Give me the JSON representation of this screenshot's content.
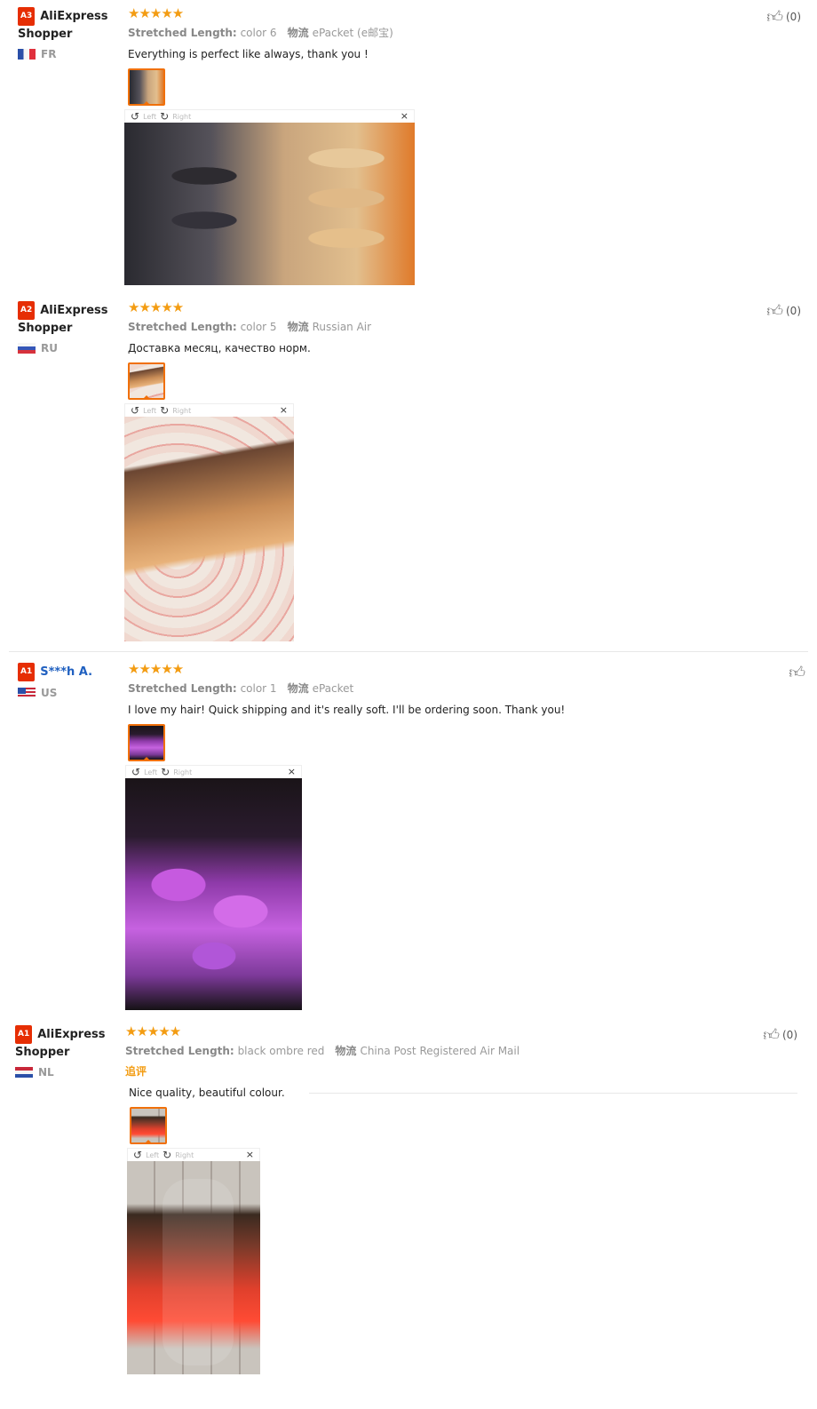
{
  "reviews": [
    {
      "level": "A3",
      "user": "AliExpress Shopper",
      "country": "FR",
      "stars": "★★★★★",
      "attr_label": "Stretched Length:",
      "attr_value": "color 6",
      "ship_label": "物流",
      "ship_value": "ePacket (e邮宝)",
      "text": "Everything is perfect like always, thank you !",
      "likes": "(0)",
      "viewer": {
        "left": "Left",
        "right": "Right",
        "close": "×"
      }
    },
    {
      "level": "A2",
      "user": "AliExpress Shopper",
      "country": "RU",
      "stars": "★★★★★",
      "attr_label": "Stretched Length:",
      "attr_value": "color 5",
      "ship_label": "物流",
      "ship_value": "Russian Air",
      "text": "Доставка месяц, качество норм.",
      "likes": "(0)",
      "viewer": {
        "left": "Left",
        "right": "Right",
        "close": "×"
      }
    },
    {
      "level": "A1",
      "user": "S***h A.",
      "country": "US",
      "stars": "★★★★★",
      "attr_label": "Stretched Length:",
      "attr_value": "color 1",
      "ship_label": "物流",
      "ship_value": "ePacket",
      "text": "I love my hair! Quick shipping and it's really soft. I'll be ordering soon. Thank you!",
      "likes": "",
      "viewer": {
        "left": "Left",
        "right": "Right",
        "close": "×"
      }
    },
    {
      "level": "A1",
      "user": "AliExpress Shopper",
      "country": "NL",
      "stars": "★★★★★",
      "attr_label": "Stretched Length:",
      "attr_value": "black ombre red",
      "ship_label": "物流",
      "ship_value": "China Post Registered Air Mail",
      "followup": "追评",
      "text": "Nice quality, beautiful colour.",
      "likes": "(0)",
      "viewer": {
        "left": "Left",
        "right": "Right",
        "close": "×"
      }
    }
  ]
}
